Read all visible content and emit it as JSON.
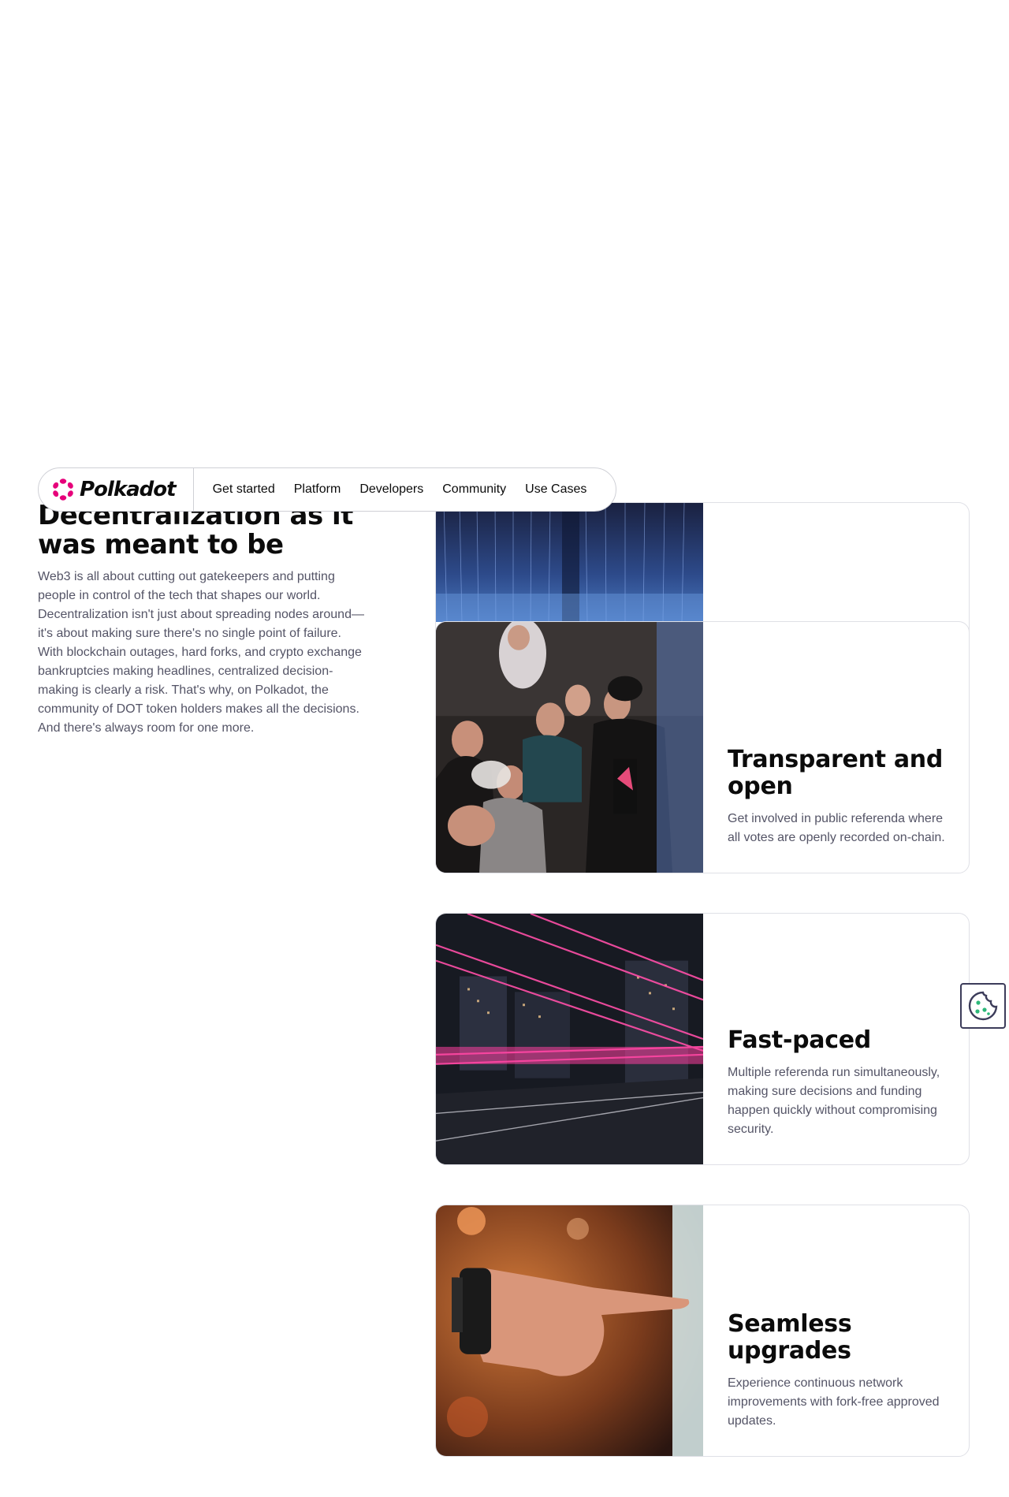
{
  "nav": {
    "brand": "Polkadot",
    "items": [
      "Get started",
      "Platform",
      "Developers",
      "Community",
      "Use Cases"
    ]
  },
  "section": {
    "heading": "Decentralization as it was meant to be",
    "body": "Web3 is all about cutting out gatekeepers and putting people in control of the tech that shapes our world. Decentralization isn't just about spreading nodes around—it's about making sure there's no single point of failure. With blockchain outages, hard forks, and crypto exchange bankruptcies making headlines, centralized decision-making is clearly a risk. That's why, on Polkadot, the community of DOT token holders makes all the decisions. And there's always room for one more."
  },
  "cards": [
    {
      "title": "Transparent and open",
      "description": "Get involved in public referenda where all votes are openly recorded on-chain.",
      "image": "crowd-photo"
    },
    {
      "title": "Fast-paced",
      "description": "Multiple referenda run simultaneously, making sure decisions and funding happen quickly without compromising security.",
      "image": "light-trails-photo"
    },
    {
      "title": "Seamless upgrades",
      "description": "Experience continuous network improvements with fork-free approved updates.",
      "image": "pointing-hand-photo"
    }
  ],
  "colors": {
    "brand": "#e6007a",
    "text": "#0b0b0b",
    "muted": "#545466",
    "border": "#dfe0e6"
  }
}
